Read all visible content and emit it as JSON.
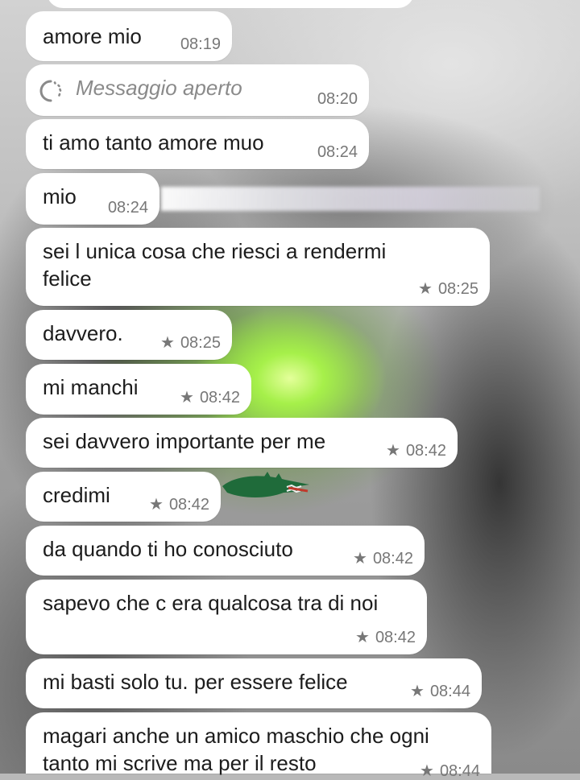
{
  "messages": [
    {
      "id": "m1",
      "text": "amore mio",
      "time": "08:19",
      "starred": false
    },
    {
      "id": "m2",
      "text": "Messaggio aperto",
      "time": "08:20",
      "starred": false,
      "system": true
    },
    {
      "id": "m3",
      "text": "ti amo tanto amore muo",
      "time": "08:24",
      "starred": false
    },
    {
      "id": "m4",
      "text": "mio",
      "time": "08:24",
      "starred": false
    },
    {
      "id": "m5",
      "text_lines": [
        "sei l unica cosa che riesci a rendermi",
        "felice"
      ],
      "time": "08:25",
      "starred": true
    },
    {
      "id": "m6",
      "text": "davvero.",
      "time": "08:25",
      "starred": true
    },
    {
      "id": "m7",
      "text": "mi manchi",
      "time": "08:42",
      "starred": true
    },
    {
      "id": "m8",
      "text": "sei davvero importante per me",
      "time": "08:42",
      "starred": true
    },
    {
      "id": "m9",
      "text": "credimi",
      "time": "08:42",
      "starred": true
    },
    {
      "id": "m10",
      "text": "da quando ti ho conosciuto",
      "time": "08:42",
      "starred": true
    },
    {
      "id": "m11",
      "text": "sapevo che c era qualcosa tra di noi",
      "time": "08:42",
      "starred": true
    },
    {
      "id": "m12",
      "text": "mi basti solo tu. per essere felice",
      "time": "08:44",
      "starred": true
    },
    {
      "id": "m13",
      "text_lines": [
        "magari anche un amico maschio che ogni",
        "tanto mi scrive ma per il resto"
      ],
      "time": "08:44",
      "starred": true
    }
  ],
  "icons": {
    "star": "star-icon",
    "opened": "loading-circle-icon"
  },
  "colors": {
    "bubble": "#ffffff",
    "text": "#1c1c1c",
    "meta": "#777777",
    "system_text": "#8a8a8a"
  }
}
